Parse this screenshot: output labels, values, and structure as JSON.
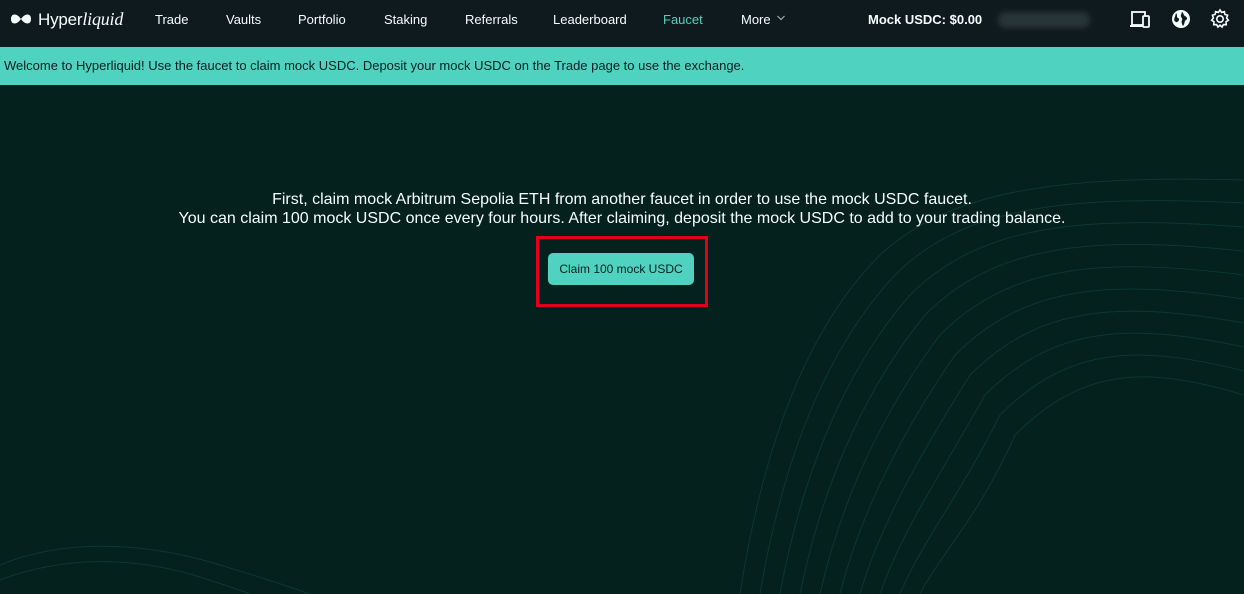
{
  "header": {
    "logo_text_a": "Hyper",
    "logo_text_b": "liquid",
    "nav": [
      {
        "label": "Trade"
      },
      {
        "label": "Vaults"
      },
      {
        "label": "Portfolio"
      },
      {
        "label": "Staking"
      },
      {
        "label": "Referrals"
      },
      {
        "label": "Leaderboard"
      },
      {
        "label": "Faucet",
        "active": true
      },
      {
        "label": "More"
      }
    ],
    "mock_balance": "Mock USDC: $0.00",
    "icons": [
      "device-icon",
      "globe-icon",
      "gear-icon"
    ]
  },
  "banner": {
    "text": "Welcome to Hyperliquid! Use the faucet to claim mock USDC. Deposit your mock USDC on the Trade page to use the exchange."
  },
  "faucet": {
    "line1": "First, claim mock Arbitrum Sepolia ETH from another faucet in order to use the mock USDC faucet.",
    "line2": "You can claim 100 mock USDC once every four hours. After claiming, deposit the mock USDC to add to your trading balance.",
    "claim_label": "Claim 100 mock USDC"
  },
  "colors": {
    "background": "#04211d",
    "topbar": "#0f1a1f",
    "accent": "#50d2c1",
    "highlight": "#e0001b",
    "text": "#f6fefd"
  }
}
